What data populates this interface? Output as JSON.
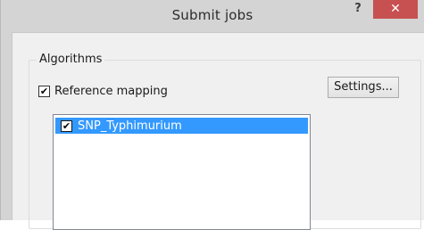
{
  "window": {
    "title": "Submit jobs",
    "help_label": "?",
    "close_label": "✕"
  },
  "algorithms": {
    "group_label": "Algorithms",
    "reference_mapping": {
      "label": "Reference mapping",
      "checked": true,
      "check_glyph": "✔"
    },
    "settings_button": "Settings...",
    "list": [
      {
        "label": "SNP_Typhimurium",
        "checked": true,
        "selected": true,
        "check_glyph": "✔"
      }
    ]
  },
  "colors": {
    "selection": "#3399ff",
    "close_button": "#c75050"
  }
}
